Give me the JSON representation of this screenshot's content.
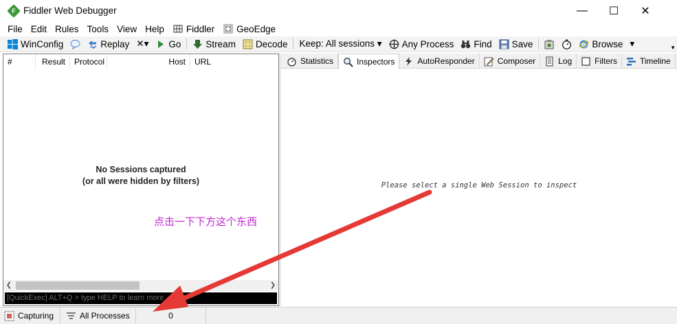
{
  "window": {
    "title": "Fiddler Web Debugger",
    "minimize": "—",
    "maximize": "☐",
    "close": "✕"
  },
  "menu": [
    "File",
    "Edit",
    "Rules",
    "Tools",
    "View",
    "Help",
    "Fiddler",
    "GeoEdge"
  ],
  "toolbar": {
    "winconfig": "WinConfig",
    "replay": "Replay",
    "remove": "✕▾",
    "go": "Go",
    "stream": "Stream",
    "decode": "Decode",
    "keep": "Keep: All sessions ▾",
    "any_process": "Any Process",
    "find": "Find",
    "save": "Save",
    "browse": "Browse",
    "browse_drop": "▾"
  },
  "columns": [
    "#",
    "Result",
    "Protocol",
    "Host",
    "URL"
  ],
  "sessions": {
    "empty_line1": "No Sessions captured",
    "empty_line2": "(or all were hidden by filters)"
  },
  "quickexec": {
    "placeholder": "[QuickExec] ALT+Q > type HELP to learn more"
  },
  "annotation": "点击一下下方这个东西",
  "tabs": [
    "Statistics",
    "Inspectors",
    "AutoResponder",
    "Composer",
    "Log",
    "Filters",
    "Timeline"
  ],
  "inspector_message": "Please select a single Web Session to inspect",
  "status": {
    "capturing": "Capturing",
    "processes": "All Processes",
    "count": "0"
  },
  "colors": {
    "accent_green": "#3c9a3a",
    "annotation_magenta": "#c026d3",
    "arrow_red": "#e53935"
  }
}
